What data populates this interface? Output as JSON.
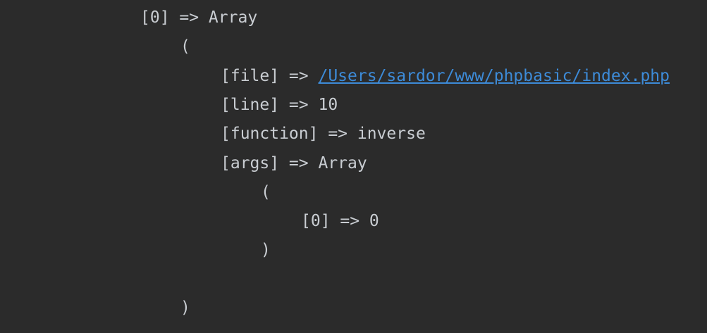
{
  "output": {
    "root_key": "[0] => Array",
    "open_paren": "(",
    "file_key": "[file] => ",
    "file_path": "/Users/sardor/www/phpbasic/index.php",
    "line_entry": "[line] => 10",
    "function_entry": "[function] => inverse",
    "args_entry": "[args] => Array",
    "args_open": "(",
    "args_item": "[0] => 0",
    "args_close": ")",
    "close_paren": ")"
  },
  "colors": {
    "background": "#2b2b2b",
    "text": "#c9cdd2",
    "link": "#3d8bd8"
  }
}
